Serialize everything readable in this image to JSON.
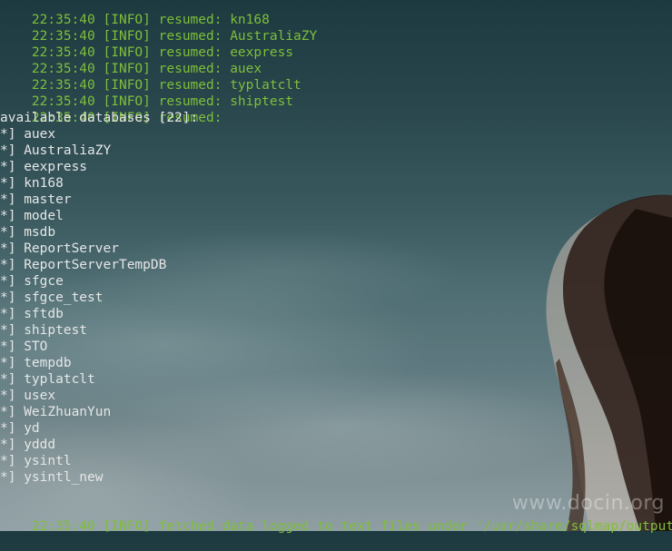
{
  "log_lines": [
    {
      "time": "22:35:40",
      "level": "[INFO]",
      "message": "resumed: kn168"
    },
    {
      "time": "22:35:40",
      "level": "[INFO]",
      "message": "resumed: AustraliaZY"
    },
    {
      "time": "22:35:40",
      "level": "[INFO]",
      "message": "resumed: eexpress"
    },
    {
      "time": "22:35:40",
      "level": "[INFO]",
      "message": "resumed: auex"
    },
    {
      "time": "22:35:40",
      "level": "[INFO]",
      "message": "resumed: typlatclt"
    },
    {
      "time": "22:35:40",
      "level": "[INFO]",
      "message": "resumed: shiptest"
    },
    {
      "time": "22:35:40",
      "level": "[INFO]",
      "message": "resumed:"
    }
  ],
  "databases_header": "available databases [22]:",
  "bullet": "*]",
  "databases": [
    "auex",
    "AustraliaZY",
    "eexpress",
    "kn168",
    "master",
    "model",
    "msdb",
    "ReportServer",
    "ReportServerTempDB",
    "sfgce",
    "sfgce_test",
    "sftdb",
    "shiptest",
    "STO",
    "tempdb",
    "typlatclt",
    "usex",
    "WeiZhuanYun",
    "yd",
    "yddd",
    "ysintl",
    "ysintl_new"
  ],
  "footer": {
    "time": "22:35:40",
    "level": "[INFO]",
    "message": "fetched data logged to text files under '/usr/share/sqlmap/output"
  },
  "watermark": "www.docin.org"
}
